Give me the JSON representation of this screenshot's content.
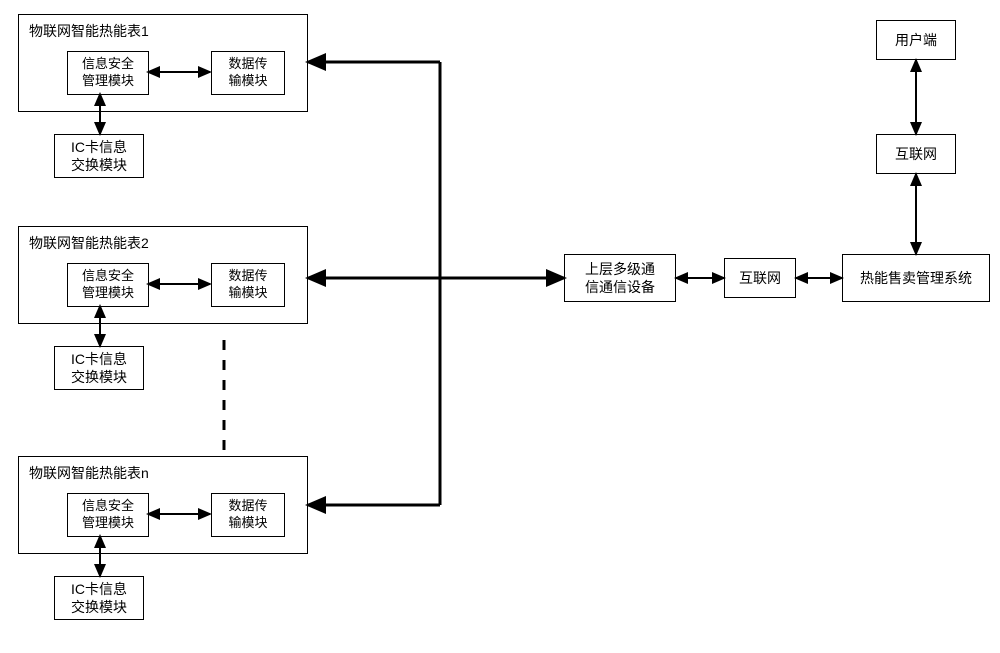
{
  "meters": [
    {
      "title": "物联网智能热能表1",
      "security": "信息安全\n管理模块",
      "transmission": "数据传\n输模块",
      "ic": "IC卡信息\n交换模块"
    },
    {
      "title": "物联网智能热能表2",
      "security": "信息安全\n管理模块",
      "transmission": "数据传\n输模块",
      "ic": "IC卡信息\n交换模块"
    },
    {
      "title": "物联网智能热能表n",
      "security": "信息安全\n管理模块",
      "transmission": "数据传\n输模块",
      "ic": "IC卡信息\n交换模块"
    }
  ],
  "right": {
    "user": "用户端",
    "internet1": "互联网",
    "internet2": "互联网",
    "upper": "上层多级通\n信通信设备",
    "system": "热能售卖管理系统"
  }
}
